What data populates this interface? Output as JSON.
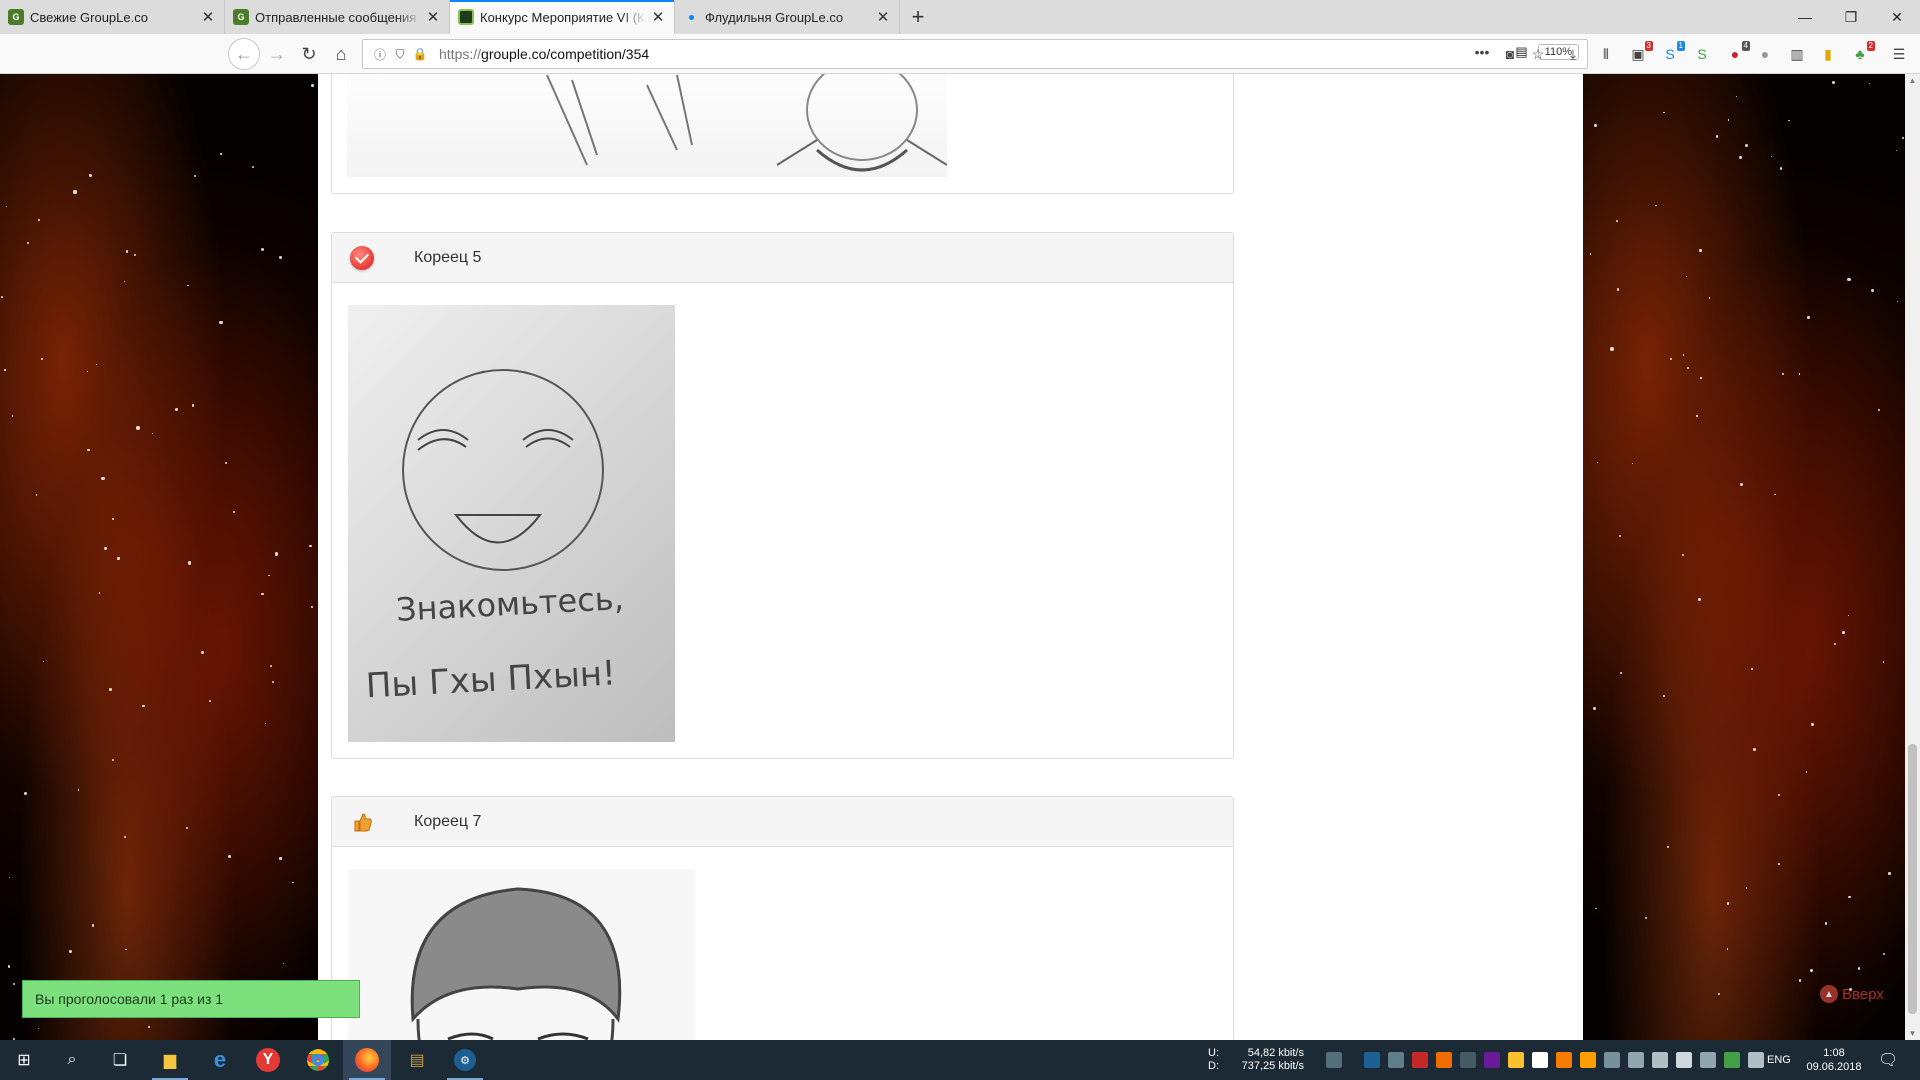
{
  "browser": {
    "tabs": [
      {
        "title": "Свежие GroupLe.co",
        "active": false
      },
      {
        "title": "Отправленные сообщения th",
        "active": false
      },
      {
        "title": "Конкурс Мероприятие VI (Ка",
        "active": true
      },
      {
        "title": "Флудильня GroupLe.co",
        "active": false
      }
    ],
    "new_tab_label": "+",
    "url_prefix": "https://",
    "url_main": "grouple.co/competition/354",
    "zoom": "110%",
    "badges": {
      "b1": "3",
      "b2": "1",
      "b3": "4",
      "b4": "2"
    }
  },
  "entries": [
    {
      "title": "Кореец 5",
      "icon": "heart-check-icon",
      "drawing_text_1": "Знакомьтесь,",
      "drawing_text_2": "Пы Гхы Пхын!"
    },
    {
      "title": "Кореец 7",
      "icon": "thumbs-up-icon"
    }
  ],
  "notice": {
    "text": "Вы проголосовали 1 раз из 1"
  },
  "scroll_top": {
    "label": "Вверх"
  },
  "taskbar": {
    "net_upload_label": "U:",
    "net_download_label": "D:",
    "net_upload": "54,82 kbit/s",
    "net_download": "737,25 kbit/s",
    "lang": "ENG",
    "time": "1:08",
    "date": "09.06.2018"
  },
  "colors": {
    "accent": "#0a84ff",
    "notice_bg": "#7ce07c",
    "heart": "#e53935"
  }
}
